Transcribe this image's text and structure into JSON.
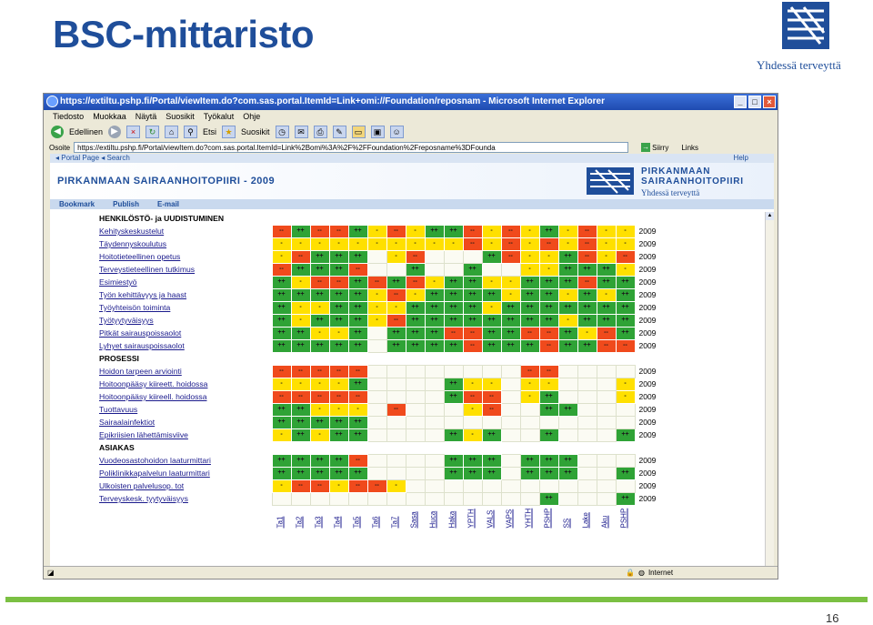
{
  "slide": {
    "title": "BSC-mittaristo",
    "slogan": "Yhdessä terveyttä",
    "page_number": "16"
  },
  "browser": {
    "window_title": "https://extiltu.pshp.fi/Portal/viewItem.do?com.sas.portal.ItemId=Link+omi://Foundation/reposnam - Microsoft Internet Explorer",
    "menu": [
      "Tiedosto",
      "Muokkaa",
      "Näytä",
      "Suosikit",
      "Työkalut",
      "Ohje"
    ],
    "back_label": "Edellinen",
    "search_label": "Etsi",
    "favorites_label": "Suosikit",
    "address_label": "Osoite",
    "address_value": "https://extiltu.pshp.fi/Portal/viewItem.do?com.sas.portal.ItemId=Link%2Bomi%3A%2F%2FFoundation%2Freposname%3DFounda",
    "go_label": "Siirry",
    "links_label": "Links",
    "status_zone": "Internet"
  },
  "portal": {
    "tabs": "◂ Portal Page  ◂ Search",
    "help": "Help",
    "title": "PIRKANMAAN SAIRAANHOITOPIIRI - 2009",
    "org_line1": "PIRKANMAAN",
    "org_line2": "SAIRAANHOITOPIIRI",
    "slogan": "Yhdessä terveyttä",
    "links": [
      "Bookmark",
      "Publish",
      "E-mail"
    ]
  },
  "bsc": {
    "columns": [
      "Ta1",
      "Ta2",
      "Ta3",
      "Ta4",
      "Ta5",
      "Ta6",
      "Ta7",
      "Sasa",
      "Huca",
      "Haka",
      "YPTH",
      "VALS",
      "VAPS",
      "YHTH",
      "PSHP",
      "SS",
      "Lake",
      "Aku",
      "PSHP"
    ],
    "rows": [
      {
        "type": "section",
        "label": "HENKILÖSTÖ- ja UUDISTUMINEN"
      },
      {
        "type": "row",
        "label": "Kehityskeskustelut",
        "year": "2009",
        "cells": "RGRRGYRYGGRYRYGYRYY"
      },
      {
        "type": "row",
        "label": "Täydennyskoulutus",
        "year": "2009",
        "cells": "YYYYYYYYYYRYRYRYRYY"
      },
      {
        "type": "row",
        "label": "Hoitotieteellinen opetus",
        "year": "2009",
        "cells": "YRGGGEYREEEGRYYGRYR"
      },
      {
        "type": "row",
        "label": "Terveystieteellinen tutkimus",
        "year": "2009",
        "cells": "RGGGREEGEEGEEYYGGGY"
      },
      {
        "type": "row",
        "label": "Esimiestyö",
        "year": "2009",
        "cells": "GYRRGRGRYGGYYGGGRGG"
      },
      {
        "type": "row",
        "label": "Työn kehittävyys ja haast",
        "year": "2009",
        "cells": "GGGGGYRYGGGGYGGYGYG"
      },
      {
        "type": "row",
        "label": "Työyhteisön toiminta",
        "year": "2009",
        "cells": "GYYGGYYGGGGYGGGGGGG"
      },
      {
        "type": "row",
        "label": "Työtyytyväisyys",
        "year": "2009",
        "cells": "GYGGGYRGGGGGGGGYGGG"
      },
      {
        "type": "row",
        "label": "Pitkät sairauspoissaolot",
        "year": "2009",
        "cells": "GGYYGEGGGRRGGRRGYRG"
      },
      {
        "type": "row",
        "label": "Lyhyet sairauspoissaolot",
        "year": "2009",
        "cells": "GGGGGEGGGGRGGGRGGRR"
      },
      {
        "type": "section",
        "label": "PROSESSI"
      },
      {
        "type": "row",
        "label": "Hoidon tarpeen arviointi",
        "year": "2009",
        "cells": "RRRRREEEEEEEERREEEE"
      },
      {
        "type": "row",
        "label": "Hoitoonpääsy kiireett. hoidossa",
        "year": "2009",
        "cells": "YYYYGEEEEGYYEYYEEEY"
      },
      {
        "type": "row",
        "label": "Hoitoonpääsy kiireell. hoidossa",
        "year": "2009",
        "cells": "RRRRREEEEGRREYGEEEY"
      },
      {
        "type": "row",
        "label": "Tuottavuus",
        "year": "2009",
        "cells": "GGYYYEREEEYREEGGEEE"
      },
      {
        "type": "row",
        "label": "Sairaalainfektiot",
        "year": "2009",
        "cells": "GGGGGEEEEEEEEEEEEEE"
      },
      {
        "type": "row",
        "label": "Epikriisien lähettämisviive",
        "year": "2009",
        "cells": "YGYGGEEEEGYGEEGEEEG"
      },
      {
        "type": "section",
        "label": "ASIAKAS"
      },
      {
        "type": "row",
        "label": "Vuodeosastohoidon laaturmittari",
        "year": "2009",
        "cells": "GGGGREEEEGGGEGGGEEE"
      },
      {
        "type": "row",
        "label": "Poliklinikkapalvelun laaturmittari",
        "year": "2009",
        "cells": "GGGGGEEEEGGGEGGGEEG"
      },
      {
        "type": "row",
        "label": "Ulkoisten palvelusop. tot",
        "year": "2009",
        "cells": "YRRYRRYEEEEEEEEEEEE"
      },
      {
        "type": "row",
        "label": "Terveyskesk. tyytyväisyys",
        "year": "2009",
        "cells": "EEEEEEEEEEEEEEGEEEG"
      }
    ],
    "legend": {
      "G": "++",
      "Y": "-",
      "R": "--"
    }
  },
  "colors": {
    "green": "#2fa336",
    "yellow": "#ffe000",
    "red": "#f04a1c",
    "brand": "#1f4e9a",
    "bottom_line": "#7bc043"
  }
}
